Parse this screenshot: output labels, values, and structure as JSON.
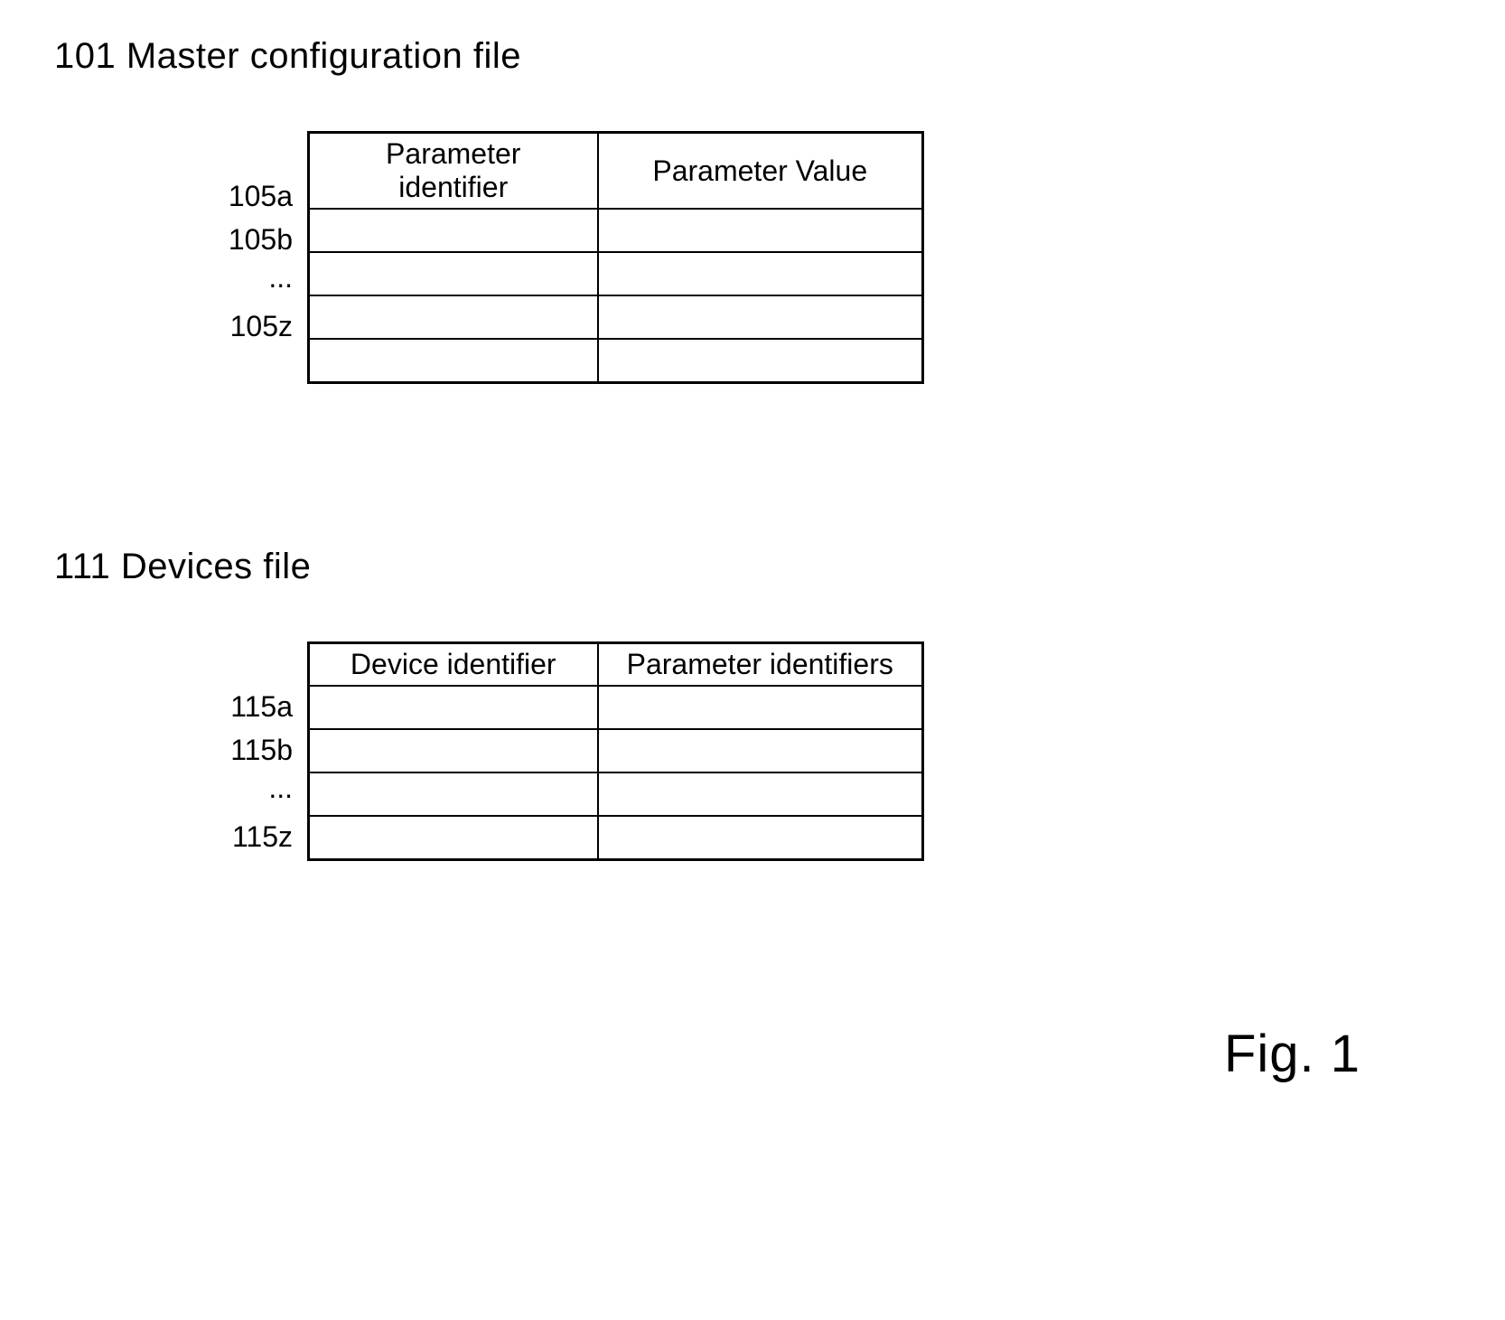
{
  "sections": [
    {
      "title": "101 Master configuration file",
      "table": {
        "headers": [
          "Parameter identifier",
          "Parameter Value"
        ],
        "rows": [
          {
            "label": "105a",
            "cells": [
              "",
              ""
            ]
          },
          {
            "label": "105b",
            "cells": [
              "",
              ""
            ]
          },
          {
            "label": "...",
            "cells": [
              "",
              ""
            ]
          },
          {
            "label": "105z",
            "cells": [
              "",
              ""
            ]
          }
        ]
      }
    },
    {
      "title": "111 Devices file",
      "table": {
        "headers": [
          "Device identifier",
          "Parameter identifiers"
        ],
        "rows": [
          {
            "label": "115a",
            "cells": [
              "",
              ""
            ]
          },
          {
            "label": "115b",
            "cells": [
              "",
              ""
            ]
          },
          {
            "label": "...",
            "cells": [
              "",
              ""
            ]
          },
          {
            "label": "115z",
            "cells": [
              "",
              ""
            ]
          }
        ]
      }
    }
  ],
  "figure_caption": "Fig. 1"
}
